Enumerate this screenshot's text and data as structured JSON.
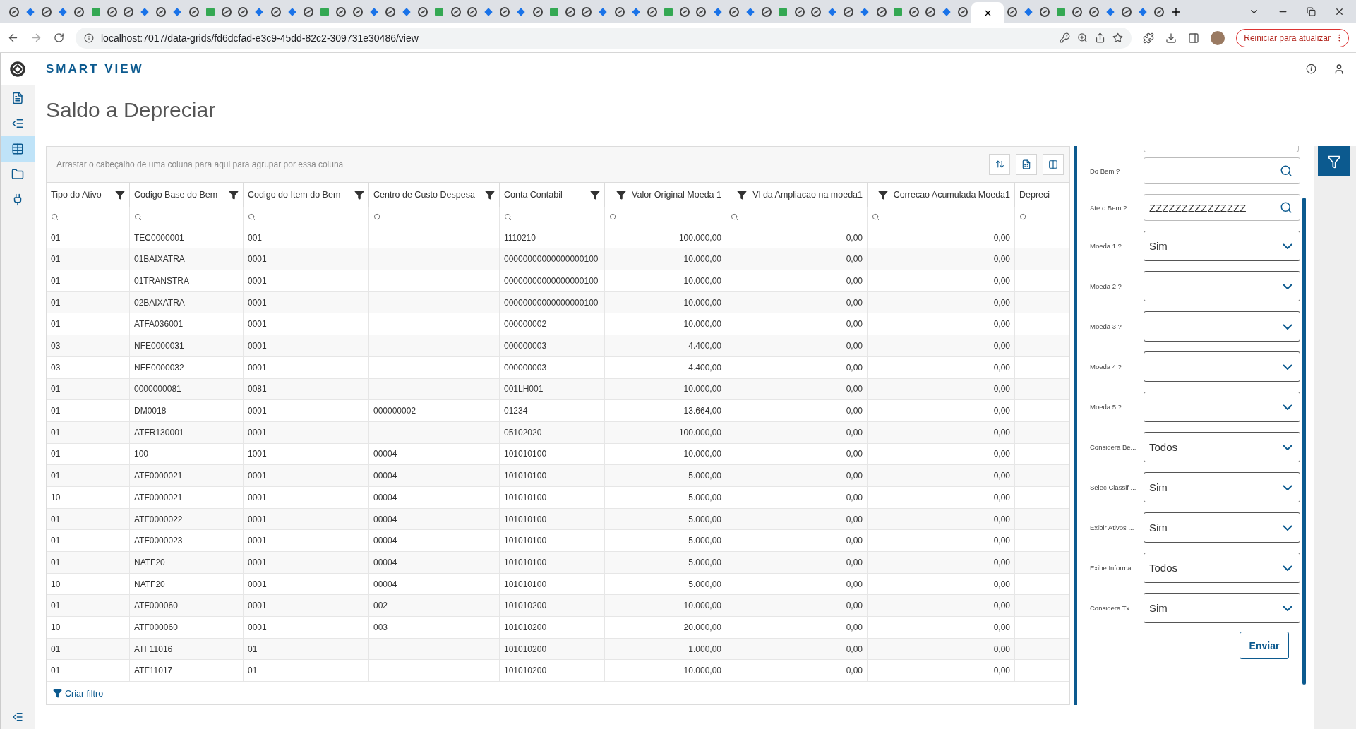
{
  "browser": {
    "url": "localhost:7017/data-grids/fd6dcfad-e3c9-45dd-82c2-309731e30486/view",
    "update_button": "Reiniciar para atualizar"
  },
  "app": {
    "title": "SMART VIEW"
  },
  "sidebar": {
    "items": [
      {
        "kind": "report",
        "selected": false
      },
      {
        "kind": "summary",
        "selected": false
      },
      {
        "kind": "grid",
        "selected": true
      },
      {
        "kind": "folder",
        "selected": false
      },
      {
        "kind": "plug",
        "selected": false
      }
    ]
  },
  "page_title": "Saldo a Depreciar",
  "grid": {
    "group_hint": "Arrastar o cabeçalho de uma coluna para aqui para agrupar por essa coluna",
    "columns": [
      {
        "label": "Tipo do Ativo",
        "kind": "text"
      },
      {
        "label": "Codigo Base do Bem",
        "kind": "text"
      },
      {
        "label": "Codigo do Item do Bem",
        "kind": "text"
      },
      {
        "label": "Centro de Custo Despesa",
        "kind": "text"
      },
      {
        "label": "Conta Contabil",
        "kind": "text"
      },
      {
        "label": "Valor Original Moeda 1",
        "kind": "number"
      },
      {
        "label": "Vl da Ampliacao na moeda1",
        "kind": "number"
      },
      {
        "label": "Correcao Acumulada Moeda1",
        "kind": "number"
      },
      {
        "label": "Depreci",
        "kind": "text"
      }
    ],
    "rows": [
      [
        "01",
        "TEC0000001",
        "001",
        "",
        "1110210",
        "100.000,00",
        "0,00",
        "0,00"
      ],
      [
        "01",
        "01BAIXATRA",
        "0001",
        "",
        "00000000000000000100",
        "10.000,00",
        "0,00",
        "0,00"
      ],
      [
        "01",
        "01TRANSTRA",
        "0001",
        "",
        "00000000000000000100",
        "10.000,00",
        "0,00",
        "0,00"
      ],
      [
        "01",
        "02BAIXATRA",
        "0001",
        "",
        "00000000000000000100",
        "10.000,00",
        "0,00",
        "0,00"
      ],
      [
        "01",
        "ATFA036001",
        "0001",
        "",
        "000000002",
        "10.000,00",
        "0,00",
        "0,00"
      ],
      [
        "03",
        "NFE0000031",
        "0001",
        "",
        "000000003",
        "4.400,00",
        "0,00",
        "0,00"
      ],
      [
        "03",
        "NFE0000032",
        "0001",
        "",
        "000000003",
        "4.400,00",
        "0,00",
        "0,00"
      ],
      [
        "01",
        "0000000081",
        "0081",
        "",
        "001LH001",
        "10.000,00",
        "0,00",
        "0,00"
      ],
      [
        "01",
        "DM0018",
        "0001",
        "000000002",
        "01234",
        "13.664,00",
        "0,00",
        "0,00"
      ],
      [
        "01",
        "ATFR130001",
        "0001",
        "",
        "05102020",
        "100.000,00",
        "0,00",
        "0,00"
      ],
      [
        "01",
        "100",
        "1001",
        "00004",
        "101010100",
        "10.000,00",
        "0,00",
        "0,00"
      ],
      [
        "01",
        "ATF0000021",
        "0001",
        "00004",
        "101010100",
        "5.000,00",
        "0,00",
        "0,00"
      ],
      [
        "10",
        "ATF0000021",
        "0001",
        "00004",
        "101010100",
        "5.000,00",
        "0,00",
        "0,00"
      ],
      [
        "01",
        "ATF0000022",
        "0001",
        "00004",
        "101010100",
        "5.000,00",
        "0,00",
        "0,00"
      ],
      [
        "01",
        "ATF0000023",
        "0001",
        "00004",
        "101010100",
        "5.000,00",
        "0,00",
        "0,00"
      ],
      [
        "01",
        "NATF20",
        "0001",
        "00004",
        "101010100",
        "5.000,00",
        "0,00",
        "0,00"
      ],
      [
        "10",
        "NATF20",
        "0001",
        "00004",
        "101010100",
        "5.000,00",
        "0,00",
        "0,00"
      ],
      [
        "01",
        "ATF000060",
        "0001",
        "002",
        "101010200",
        "10.000,00",
        "0,00",
        "0,00"
      ],
      [
        "10",
        "ATF000060",
        "0001",
        "003",
        "101010200",
        "20.000,00",
        "0,00",
        "0,00"
      ],
      [
        "01",
        "ATF11016",
        "01",
        "",
        "101010200",
        "1.000,00",
        "0,00",
        "0,00"
      ],
      [
        "01",
        "ATF11017",
        "01",
        "",
        "101010200",
        "10.000,00",
        "0,00",
        "0,00"
      ]
    ],
    "footer_link": "Criar filtro"
  },
  "filter_panel": {
    "fields": [
      {
        "label": "Do Bem ?",
        "kind": "lookup"
      },
      {
        "label": "Ate o Bem ?",
        "kind": "lookup",
        "value": "ZZZZZZZZZZZZZZZ"
      },
      {
        "label": "Moeda 1 ?",
        "kind": "select",
        "value": "Sim"
      },
      {
        "label": "Moeda 2 ?",
        "kind": "select"
      },
      {
        "label": "Moeda 3 ?",
        "kind": "select"
      },
      {
        "label": "Moeda 4 ?",
        "kind": "select"
      },
      {
        "label": "Moeda 5 ?",
        "kind": "select"
      },
      {
        "label": "Considera Be...",
        "kind": "select",
        "value": "Todos"
      },
      {
        "label": "Selec Classif ...",
        "kind": "select",
        "value": "Sim"
      },
      {
        "label": "Exibir Ativos ...",
        "kind": "select",
        "value": "Sim"
      },
      {
        "label": "Exibe Informa...",
        "kind": "select",
        "value": "Todos"
      },
      {
        "label": "Considera Tx ...",
        "kind": "select",
        "value": "Sim"
      }
    ],
    "submit": "Enviar"
  }
}
